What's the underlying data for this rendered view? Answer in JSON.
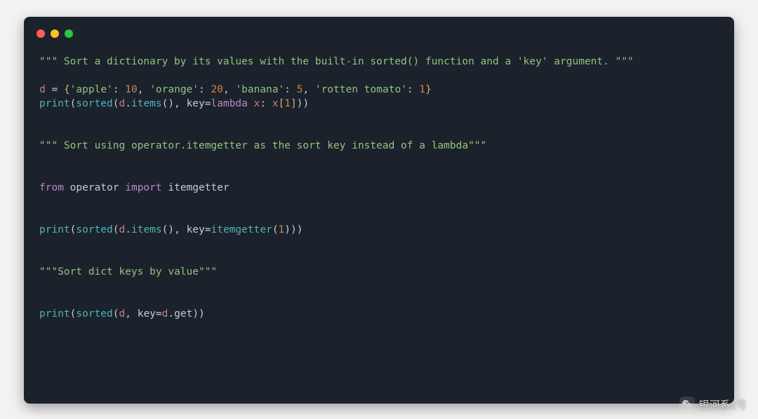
{
  "window": {
    "buttons": {
      "close": "close",
      "min": "minimize",
      "zoom": "zoom"
    }
  },
  "code": {
    "doc1_a": "\"\"\" Sort a dictionary by its values with the built-in sorted() function and a 'key' argument. \"\"\"",
    "assign_lhs": "d",
    "eq": " = ",
    "lbrace": "{",
    "k1": "'apple'",
    "c1": ": ",
    "v1": "10",
    "s1": ", ",
    "k2": "'orange'",
    "c2": ": ",
    "v2": "20",
    "s2": ", ",
    "k3": "'banana'",
    "c3": ": ",
    "v3": "5",
    "s3": ", ",
    "k4": "'rotten tomato'",
    "c4": ": ",
    "v4": "1",
    "rbrace": "}",
    "print": "print",
    "sorted": "sorted",
    "items": "items",
    "lp": "(",
    "rp": ")",
    "d": "d",
    "dot": ".",
    "key_eq": ", key=",
    "lambda": "lambda",
    "x": "x",
    "colon_sp": ": ",
    "lbrk": "[",
    "rbrk": "]",
    "one": "1",
    "doc2": "\"\"\" Sort using operator.itemgetter as the sort key instead of a lambda\"\"\"",
    "from": "from",
    "operator_mod": "operator",
    "import": "import",
    "itemgetter": "itemgetter",
    "doc3": "\"\"\"Sort dict keys by value\"\"\"",
    "get": "get"
  },
  "watermark": {
    "text": "银河系1号"
  }
}
